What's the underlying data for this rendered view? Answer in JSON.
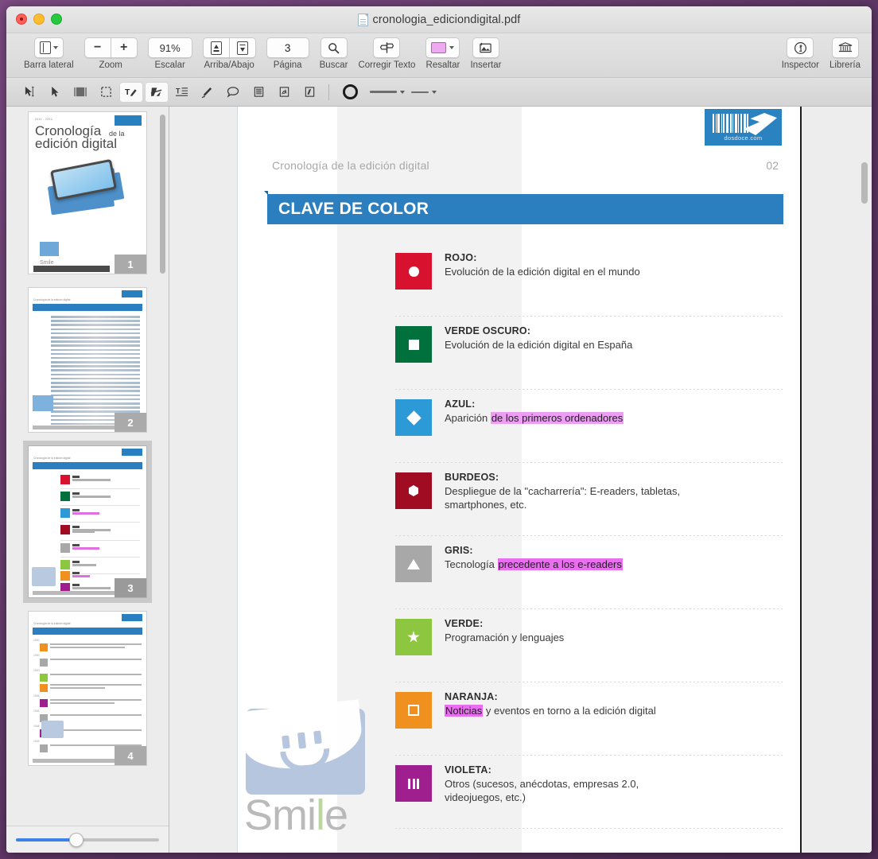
{
  "window": {
    "title": "cronologia_ediciondigital.pdf",
    "traffic_lights": [
      "close",
      "minimize",
      "zoom"
    ]
  },
  "toolbar": {
    "groups": [
      {
        "label": "Barra lateral",
        "items": [
          {
            "icon": "sidebar-icon",
            "caret": true
          }
        ]
      },
      {
        "label": "Zoom",
        "items": [
          {
            "icon": "minus-icon"
          },
          {
            "icon": "plus-icon"
          }
        ]
      },
      {
        "label": "Escalar",
        "items": [
          {
            "value": "91%"
          }
        ]
      },
      {
        "label": "Arriba/Abajo",
        "items": [
          {
            "icon": "page-up-icon"
          },
          {
            "icon": "page-down-icon"
          }
        ]
      },
      {
        "label": "Página",
        "items": [
          {
            "value": "3"
          }
        ]
      },
      {
        "label": "Buscar",
        "items": [
          {
            "icon": "search-icon"
          }
        ]
      },
      {
        "label": "Corregir Texto",
        "items": [
          {
            "icon": "text-correct-icon"
          }
        ]
      },
      {
        "label": "Resaltar",
        "items": [
          {
            "icon": "highlight-swatch",
            "color": "#eeaaf0",
            "caret": true
          }
        ]
      },
      {
        "label": "Insertar",
        "items": [
          {
            "icon": "insert-image-icon"
          }
        ]
      },
      {
        "label": "Inspector",
        "items": [
          {
            "icon": "info-icon"
          }
        ]
      },
      {
        "label": "Librería",
        "items": [
          {
            "icon": "library-icon"
          }
        ]
      }
    ],
    "zoom_value": "91%",
    "page_value": "3",
    "highlight_color": "#eeaaf0"
  },
  "annotation_bar": {
    "tools": [
      {
        "name": "text-select-tool",
        "active": false
      },
      {
        "name": "arrow-select-tool",
        "active": false
      },
      {
        "name": "page-select-tool",
        "active": false
      },
      {
        "name": "marquee-select-tool",
        "active": false
      },
      {
        "name": "text-edit-tool",
        "active": true
      },
      {
        "name": "redact-tool",
        "active": true
      },
      {
        "name": "text-box-tool",
        "active": false
      },
      {
        "name": "pen-tool",
        "active": false
      },
      {
        "name": "comment-tool",
        "active": false
      },
      {
        "name": "note-tool",
        "active": false
      },
      {
        "name": "stamp-tool",
        "active": false
      },
      {
        "name": "link-tool",
        "active": false
      },
      {
        "name": "shape-tool",
        "active": false
      },
      {
        "name": "line-style-tool",
        "active": false
      },
      {
        "name": "line-weight-tool",
        "active": false
      }
    ]
  },
  "sidebar": {
    "thumbnails": [
      {
        "page": "1",
        "selected": false,
        "title_line1": "Cronología",
        "title_small": "de la",
        "title_line2": "edición digital",
        "brand": "Smile"
      },
      {
        "page": "2",
        "selected": false
      },
      {
        "page": "3",
        "selected": true
      },
      {
        "page": "4",
        "selected": false
      }
    ],
    "zoom_slider_percent": 42
  },
  "document": {
    "running_head": "Cronología de la edición digital",
    "page_number": "02",
    "barcode_text": "dosdoce.com",
    "section_title": "CLAVE DE COLOR",
    "watermark": "Smile",
    "keys": [
      {
        "name": "ROJO:",
        "color": "#d8122e",
        "glyph": "circle",
        "desc_before": "Evolución de la edición digital en el mundo",
        "desc_highlight": "",
        "desc_after": "",
        "desc_line2": ""
      },
      {
        "name": "VERDE OSCURO:",
        "color": "#00713c",
        "glyph": "square",
        "desc_before": "Evolución de la edición digital en España",
        "desc_highlight": "",
        "desc_after": "",
        "desc_line2": ""
      },
      {
        "name": "AZUL:",
        "color": "#2d9ad8",
        "glyph": "diamond",
        "desc_before": "Aparición ",
        "desc_highlight": "de los primeros ordenadores",
        "desc_after": "",
        "desc_line2": ""
      },
      {
        "name": "BURDEOS:",
        "color": "#a00d22",
        "glyph": "hexagon",
        "desc_before": "Despliegue de la \"cacharrería\": E-readers, tabletas,",
        "desc_highlight": "",
        "desc_after": "",
        "desc_line2": "smartphones, etc."
      },
      {
        "name": "GRIS:",
        "color": "#a8a8a8",
        "glyph": "triangle",
        "desc_before": "Tecnología ",
        "desc_highlight": "precedente a los e-readers",
        "desc_after": "",
        "desc_line2": ""
      },
      {
        "name": "VERDE:",
        "color": "#8dc63f",
        "glyph": "star",
        "desc_before": "Programación y lenguajes",
        "desc_highlight": "",
        "desc_after": "",
        "desc_line2": ""
      },
      {
        "name": "NARANJA:",
        "color": "#f0901e",
        "glyph": "square-outline",
        "desc_before": "",
        "desc_highlight": "Noticias",
        "desc_after": " y eventos en torno a la edición digital",
        "desc_line2": ""
      },
      {
        "name": "VIOLETA:",
        "color": "#a01f8f",
        "glyph": "bars",
        "desc_before": "Otros (sucesos, anécdotas, empresas 2.0,",
        "desc_highlight": "",
        "desc_after": "",
        "desc_line2": "videojuegos, etc.)"
      }
    ]
  }
}
